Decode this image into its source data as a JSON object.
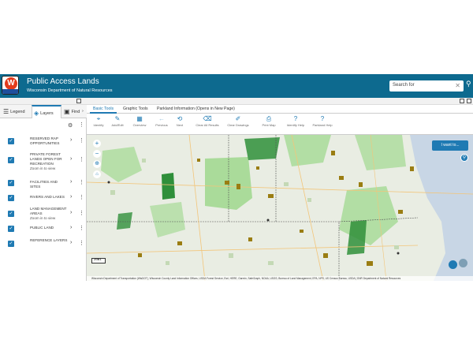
{
  "header": {
    "title": "Public Access Lands",
    "subtitle": "Wisconsin Department of Natural Resources",
    "search_placeholder": "Search for"
  },
  "left_panel": {
    "tabs": [
      {
        "label": "Legend",
        "icon": "legend-icon"
      },
      {
        "label": "Layers",
        "icon": "layers-icon"
      },
      {
        "label": "Find",
        "icon": "find-icon"
      }
    ],
    "layers": [
      {
        "name": "RESERVED RAP OPPORTUNITIES",
        "sub": "",
        "checked": true
      },
      {
        "name": "PRIVATE FOREST LANDS OPEN FOR RECREATION",
        "sub": "Zoom in to view",
        "checked": true
      },
      {
        "name": "FACILITIES AND SITES",
        "sub": "",
        "checked": true
      },
      {
        "name": "RIVERS AND LAKES",
        "sub": "",
        "checked": true
      },
      {
        "name": "LAND MANAGEMENT AREAS",
        "sub": "Zoom in to view",
        "checked": true
      },
      {
        "name": "PUBLIC LAND",
        "sub": "",
        "checked": true
      },
      {
        "name": "REFERENCE LAYERS",
        "sub": "",
        "checked": true
      }
    ]
  },
  "toolbar": {
    "tabs": [
      "Basic Tools",
      "Graphic Tools",
      "Parkland Information (Opens in New Page)"
    ],
    "active_tab": "Basic Tools",
    "tools": [
      {
        "label": "Identify",
        "icon": "identify-icon"
      },
      {
        "label": "Add/Edit",
        "icon": "add-edit-icon"
      },
      {
        "label": "Overview",
        "icon": "overview-icon"
      },
      {
        "label": "Previous",
        "icon": "previous-icon"
      },
      {
        "label": "Next",
        "icon": "next-icon"
      },
      {
        "label": "Clear All Results",
        "icon": "clear-results-icon"
      },
      {
        "label": "Clear Drawings",
        "icon": "clear-drawings-icon"
      },
      {
        "label": "Print Map",
        "icon": "print-icon"
      },
      {
        "label": "Identify Help",
        "icon": "help-icon"
      },
      {
        "label": "Parkland Help",
        "icon": "help-icon"
      }
    ]
  },
  "map": {
    "want_button": "I want to...",
    "scale_text": "20mi",
    "attribution": "Wisconsin Department of Transportation (WisDOT), Wisconsin County Land Information Offices, USDA Forest Service, Esri, HERE, Garmin, SafeGraph, NOAA, USGS, Bureau of Land Management, EPA, NPS, US Census Bureau, USDA | DNR Department of Natural Resources"
  },
  "colors": {
    "header": "#0d6a8f",
    "accent": "#1f7ab3",
    "map_base": "#e9ede3",
    "public_land": "#8ed37a",
    "forest": "#2f8f3a",
    "managed": "#9a7d12",
    "water": "#c8d6e5"
  }
}
